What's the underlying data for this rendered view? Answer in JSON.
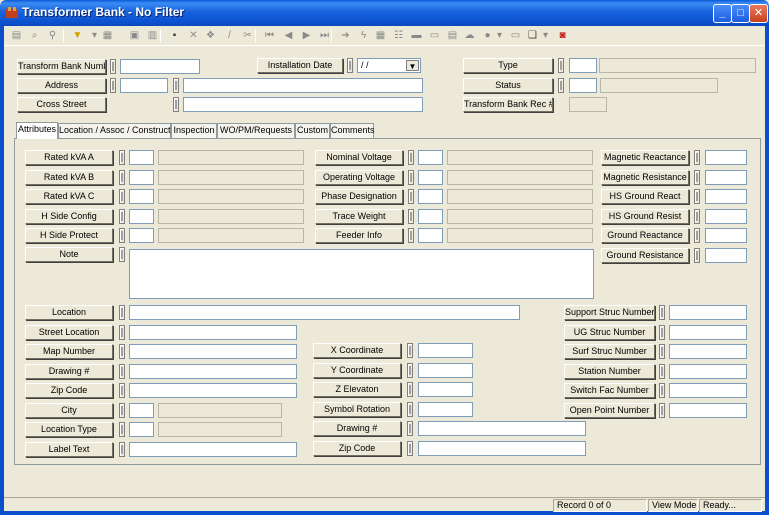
{
  "window": {
    "title": "Transformer Bank - No Filter"
  },
  "window_controls": {
    "minimize": "_",
    "maximize": "□",
    "close": "✕"
  },
  "header": {
    "transform_bank_number": {
      "label": "Transform Bank Number",
      "value": ""
    },
    "address": {
      "label": "Address",
      "value1": "",
      "value2": ""
    },
    "cross_street": {
      "label": "Cross Street",
      "value": ""
    },
    "installation_date": {
      "label": "Installation Date",
      "value": " / /"
    },
    "type": {
      "label": "Type",
      "value": ""
    },
    "status": {
      "label": "Status",
      "value": ""
    },
    "transform_bank_rec": {
      "label": "Transform Bank Rec #",
      "value": ""
    }
  },
  "tabs": [
    {
      "label": "Attributes"
    },
    {
      "label": "Location / Assoc / Construct"
    },
    {
      "label": "Inspection"
    },
    {
      "label": "WO/PM/Requests"
    },
    {
      "label": "Custom"
    },
    {
      "label": "Comments"
    }
  ],
  "attributes": {
    "col1": [
      {
        "label": "Rated kVA A"
      },
      {
        "label": "Rated kVA B"
      },
      {
        "label": "Rated kVA C"
      },
      {
        "label": "H Side Config"
      },
      {
        "label": "H Side Protect"
      }
    ],
    "col2": [
      {
        "label": "Nominal Voltage"
      },
      {
        "label": "Operating Voltage"
      },
      {
        "label": "Phase Designation"
      },
      {
        "label": "Trace Weight"
      },
      {
        "label": "Feeder Info"
      }
    ],
    "col3": [
      {
        "label": "Magnetic Reactance"
      },
      {
        "label": "Magnetic Resistance"
      },
      {
        "label": "HS Ground React"
      },
      {
        "label": "HS Ground Resist"
      },
      {
        "label": "Ground Reactance"
      },
      {
        "label": "Ground Resistance"
      }
    ],
    "note": {
      "label": "Note",
      "value": ""
    }
  },
  "location": {
    "left": [
      {
        "label": "Location"
      },
      {
        "label": "Street Location"
      },
      {
        "label": "Map Number"
      },
      {
        "label": "Drawing #"
      },
      {
        "label": "Zip Code"
      },
      {
        "label": "City"
      },
      {
        "label": "Location Type"
      },
      {
        "label": "Label Text"
      }
    ],
    "middle": [
      {
        "label": "X Coordinate"
      },
      {
        "label": "Y Coordinate"
      },
      {
        "label": "Z Elevaton"
      },
      {
        "label": "Symbol Rotation"
      },
      {
        "label": "Drawing #"
      },
      {
        "label": "Zip Code"
      }
    ],
    "right": [
      {
        "label": "Support Struc Number"
      },
      {
        "label": "UG Struc Number"
      },
      {
        "label": "Surf Struc Number"
      },
      {
        "label": "Station Number"
      },
      {
        "label": "Switch Fac Number"
      },
      {
        "label": "Open Point Number"
      }
    ]
  },
  "statusbar": {
    "record": "Record 0 of 0",
    "mode": "View Mode",
    "state": "Ready..."
  }
}
